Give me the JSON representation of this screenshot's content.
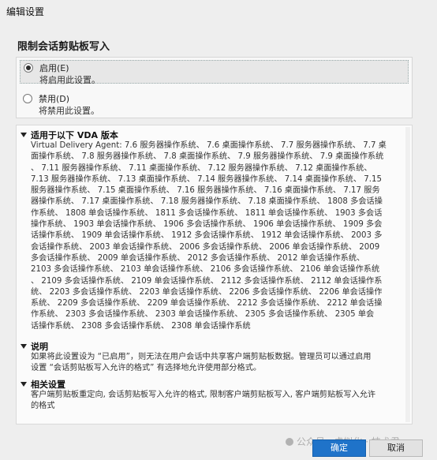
{
  "window": {
    "title": "编辑设置"
  },
  "setting": {
    "title": "限制会话剪贴板写入"
  },
  "options": [
    {
      "label": "启用(E)",
      "description": "将启用此设置。",
      "selected": true
    },
    {
      "label": "禁用(D)",
      "description": "将禁用此设置。",
      "selected": false
    }
  ],
  "sections": {
    "applies": {
      "heading": "适用于以下 VDA 版本",
      "lines": [
        "Virtual Delivery Agent: 7.6 服务器操作系统、 7.6 桌面操作系统、 7.7 服务器操作系统、 7.7 桌",
        "面操作系统、 7.8 服务器操作系统、 7.8 桌面操作系统、 7.9 服务器操作系统、 7.9 桌面操作系统",
        "、 7.11 服务器操作系统、 7.11 桌面操作系统、 7.12 服务器操作系统、 7.12 桌面操作系统、",
        "7.13 服务器操作系统、 7.13 桌面操作系统、 7.14 服务器操作系统、 7.14 桌面操作系统、 7.15",
        "服务器操作系统、 7.15 桌面操作系统、 7.16 服务器操作系统、 7.16 桌面操作系统、 7.17 服务",
        "器操作系统、 7.17 桌面操作系统、 7.18 服务器操作系统、 7.18 桌面操作系统、 1808 多会话操",
        "作系统、 1808 单会话操作系统、 1811 多会话操作系统、 1811 单会话操作系统、 1903 多会话",
        "操作系统、 1903 单会话操作系统、 1906 多会话操作系统、 1906 单会话操作系统、 1909 多会",
        "话操作系统、 1909 单会话操作系统、 1912 多会话操作系统、 1912 单会话操作系统、 2003 多",
        "会话操作系统、 2003 单会话操作系统、 2006 多会话操作系统、 2006 单会话操作系统、 2009",
        "多会话操作系统、 2009 单会话操作系统、 2012 多会话操作系统、 2012 单会话操作系统、",
        "2103 多会话操作系统、 2103 单会话操作系统、 2106 多会话操作系统、 2106 单会话操作系统",
        "、 2109 多会话操作系统、 2109 单会话操作系统、 2112 多会话操作系统、 2112 单会话操作系",
        "统、 2203 多会话操作系统、 2203 单会话操作系统、 2206 多会话操作系统、 2206 单会话操作",
        "系统、 2209 多会话操作系统、 2209 单会话操作系统、 2212 多会话操作系统、 2212 单会话操",
        "作系统、 2303 多会话操作系统、 2303 单会话操作系统、 2305 多会话操作系统、 2305 单会",
        "话操作系统、 2308 多会话操作系统、 2308 单会话操作系统"
      ]
    },
    "description": {
      "heading": "说明",
      "lines": [
        "如果将此设置设为 “已启用”，则无法在用户会话中共享客户端剪贴板数据。管理员可以通过启用",
        "设置 “会话剪贴板写入允许的格式” 有选择地允许使用部分格式。"
      ]
    },
    "related": {
      "heading": "相关设置",
      "lines": [
        "客户端剪贴板重定向, 会话剪贴板写入允许的格式, 限制客户端剪贴板写入, 客户端剪贴板写入允许",
        "的格式"
      ]
    }
  },
  "buttons": {
    "ok": "确定",
    "cancel": "取消"
  },
  "watermark": "公众号 · 虚拟化 · 技术君"
}
